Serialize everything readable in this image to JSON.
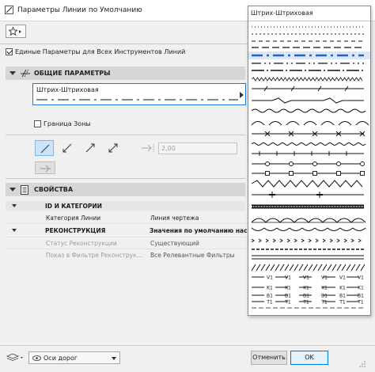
{
  "window": {
    "title": "Параметры Линии по Умолчанию"
  },
  "options": {
    "uniform_params_label": "Единые Параметры для Всех Инструментов Линий",
    "uniform_checked": true
  },
  "general": {
    "header": "ОБЩИЕ ПАРАМЕТРЫ",
    "line_type": "Штрих-Штриховая",
    "zone_boundary_label": "Граница Зоны",
    "zone_boundary_checked": false,
    "arrow_size": "2,00"
  },
  "properties": {
    "header": "СВОЙСТВА",
    "groups": [
      {
        "title": "ID И КАТЕГОРИИ",
        "rows": [
          {
            "name": "Категория Линии",
            "value": "Линия чертежа",
            "enabled": true
          }
        ]
      },
      {
        "title": "РЕКОНСТРУКЦИЯ",
        "value": "Значения по умолчанию нас",
        "rows": [
          {
            "name": "Статус Реконструкции",
            "value": "Существующий",
            "enabled": false
          },
          {
            "name": "Показ в Фильтре Реконструк...",
            "value": "Все Релевантные Фильтры",
            "enabled": false
          }
        ]
      }
    ]
  },
  "footer": {
    "layer": "Оси дорог",
    "cancel": "Отменить",
    "ok": "OK"
  },
  "popup": {
    "title": "Штрих-Штриховая",
    "selected_index": 4,
    "pattern_count": 34
  },
  "colors": {
    "accent": "#1e73d8",
    "selected_pattern": "#1e64c8",
    "header_bg": "#d6d6d6"
  }
}
